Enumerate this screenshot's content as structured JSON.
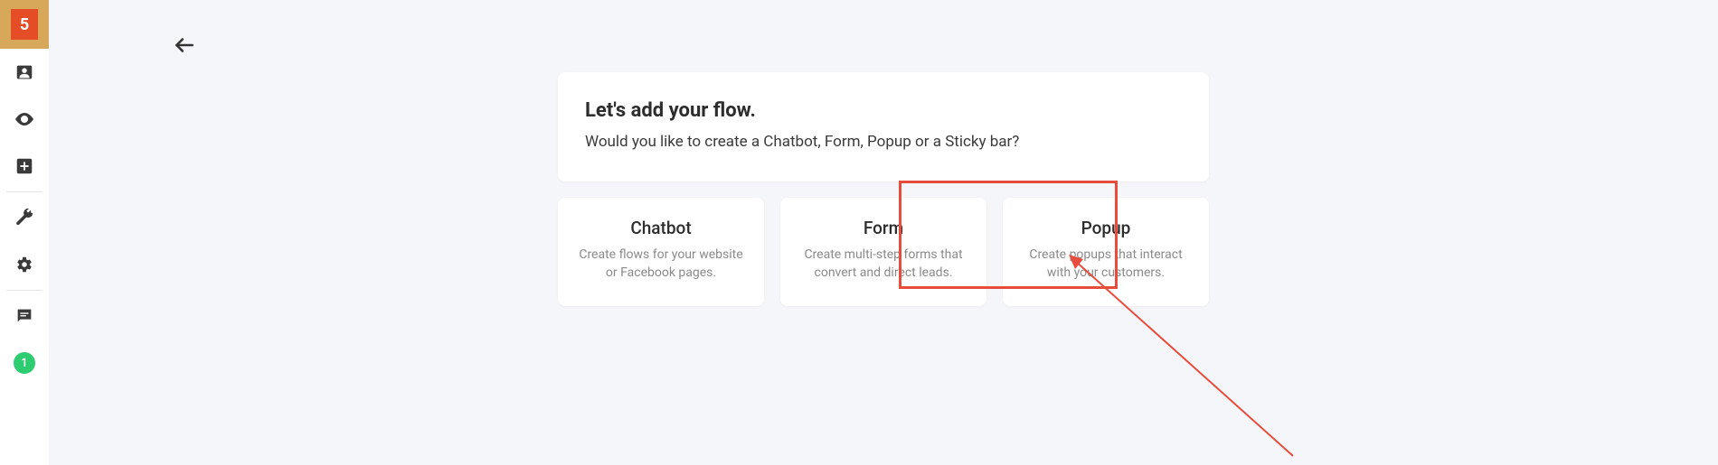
{
  "sidebar": {
    "logo_label": "HTML5",
    "items": [
      {
        "name": "contacts",
        "icon": "person-card-icon"
      },
      {
        "name": "view",
        "icon": "eye-icon"
      },
      {
        "name": "add",
        "icon": "plus-box-icon"
      },
      {
        "name": "tools",
        "icon": "wrench-icon"
      },
      {
        "name": "settings",
        "icon": "gear-icon"
      },
      {
        "name": "messages",
        "icon": "chat-icon"
      }
    ],
    "badge_count": "1"
  },
  "header": {
    "title": "Let's add your flow.",
    "subtitle": "Would you like to create a Chatbot, Form, Popup or a Sticky bar?"
  },
  "options": [
    {
      "title": "Chatbot",
      "desc": "Create flows for your website or Facebook pages."
    },
    {
      "title": "Form",
      "desc": "Create multi-step forms that convert and direct leads."
    },
    {
      "title": "Popup",
      "desc": "Create popups that interact with your customers."
    }
  ],
  "annotation": {
    "highlight_option_index": 2,
    "highlight_color": "#e74c3c"
  }
}
